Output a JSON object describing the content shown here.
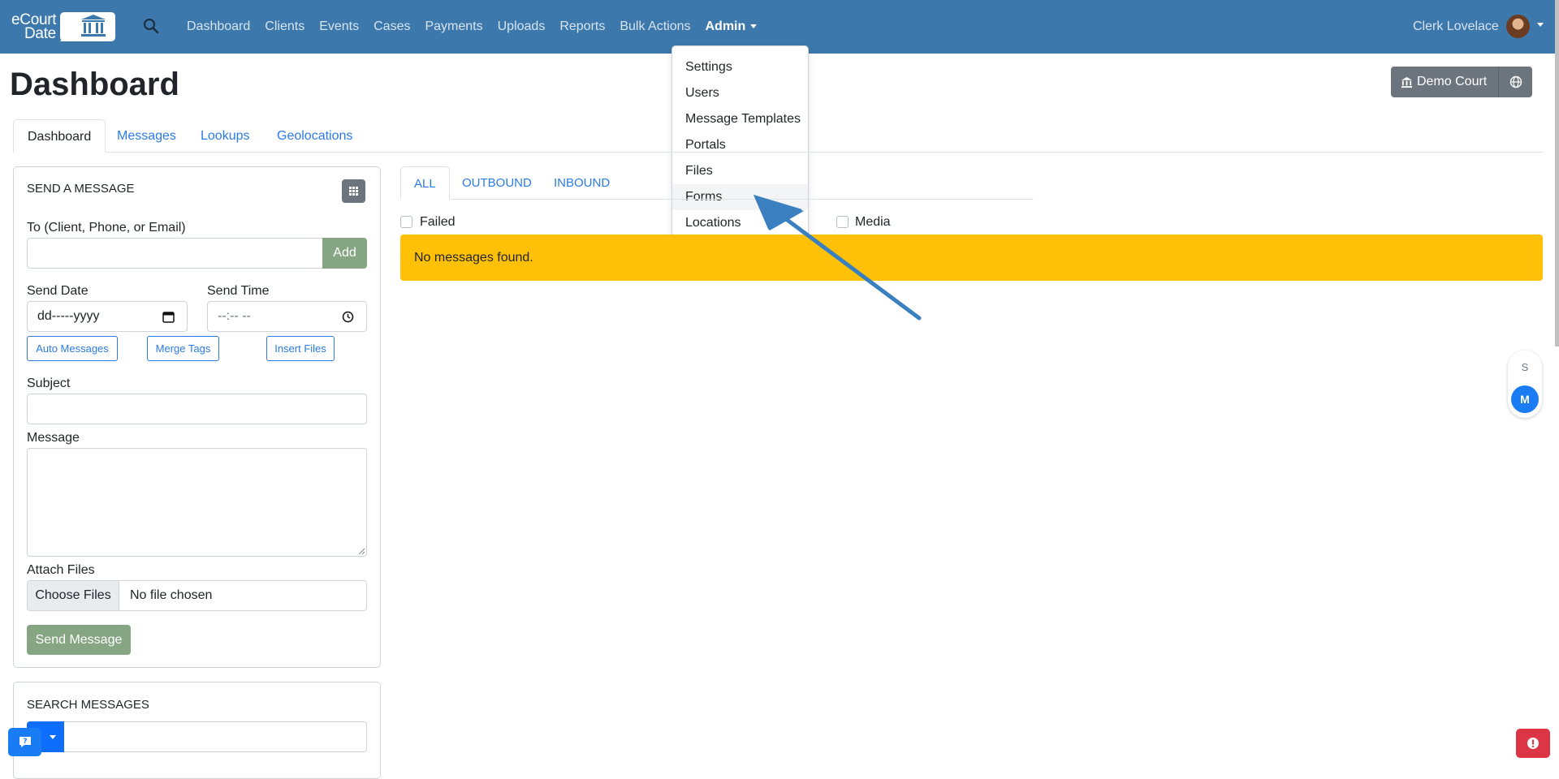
{
  "brand": {
    "logo_line1": "eCourt",
    "logo_line2": "Date"
  },
  "nav": {
    "links": [
      {
        "label": "Dashboard"
      },
      {
        "label": "Clients"
      },
      {
        "label": "Events"
      },
      {
        "label": "Cases"
      },
      {
        "label": "Payments"
      },
      {
        "label": "Uploads"
      },
      {
        "label": "Reports"
      },
      {
        "label": "Bulk Actions"
      }
    ],
    "admin_label": "Admin",
    "user_name": "Clerk Lovelace"
  },
  "admin_menu": {
    "items": [
      {
        "label": "Settings"
      },
      {
        "label": "Users"
      },
      {
        "label": "Message Templates"
      },
      {
        "label": "Portals"
      },
      {
        "label": "Files"
      },
      {
        "label": "Forms"
      },
      {
        "label": "Locations"
      }
    ],
    "hovered": "Forms"
  },
  "page": {
    "title": "Dashboard",
    "court_button": "Demo Court"
  },
  "tabs": [
    {
      "label": "Dashboard",
      "active": true
    },
    {
      "label": "Messages"
    },
    {
      "label": "Lookups"
    },
    {
      "label": "Geolocations"
    }
  ],
  "send_message": {
    "title": "SEND A MESSAGE",
    "to_label": "To (Client, Phone, or Email)",
    "add_button": "Add",
    "send_date_label": "Send Date",
    "send_date_value": "dd-----yyyy",
    "send_time_label": "Send Time",
    "send_time_value": "--:-- --",
    "auto_messages": "Auto Messages",
    "merge_tags": "Merge Tags",
    "insert_files": "Insert Files",
    "subject_label": "Subject",
    "message_label": "Message",
    "attach_label": "Attach Files",
    "choose_files": "Choose Files",
    "no_file": "No file chosen",
    "send_button": "Send Message"
  },
  "search_messages": {
    "title": "SEARCH MESSAGES"
  },
  "message_tabs": [
    {
      "label": "ALL",
      "active": true
    },
    {
      "label": "OUTBOUND"
    },
    {
      "label": "INBOUND"
    }
  ],
  "filters": {
    "failed": "Failed",
    "media": "Media"
  },
  "alert": {
    "text": "No messages found."
  },
  "side_widget": {
    "s": "S",
    "m": "M"
  },
  "colors": {
    "navbar": "#3c78ac",
    "alert": "#ffc107",
    "link": "#2c7be5",
    "green_button": "#86a583"
  }
}
